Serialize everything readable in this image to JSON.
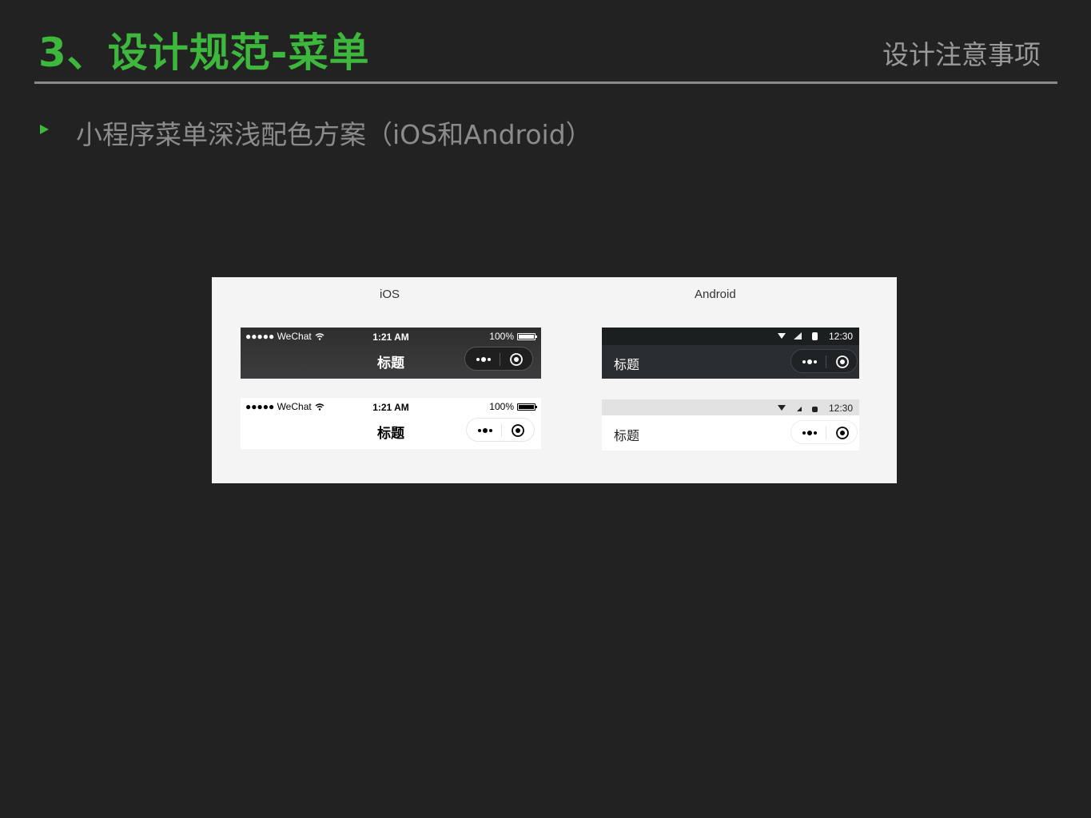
{
  "header": {
    "title": "3、设计规范-菜单",
    "section": "设计注意事项"
  },
  "bullet": {
    "text": "小程序菜单深浅配色方案（iOS和Android）"
  },
  "panel": {
    "ios_label": "iOS",
    "android_label": "Android",
    "ios_dark": {
      "carrier": "●●●●● WeChat",
      "time": "1:21 AM",
      "battery": "100%",
      "title": "标题"
    },
    "ios_light": {
      "carrier": "●●●●● WeChat",
      "time": "1:21 AM",
      "battery": "100%",
      "title": "标题"
    },
    "android_dark": {
      "time": "12:30",
      "title": "标题"
    },
    "android_light": {
      "time": "12:30",
      "title": "标题"
    }
  },
  "colors": {
    "accent_green": "#3db83d",
    "background": "#222222",
    "panel": "#f4f4f4"
  },
  "icons": [
    "wifi-icon",
    "battery-icon",
    "more-icon",
    "close-icon",
    "signal-icon"
  ]
}
